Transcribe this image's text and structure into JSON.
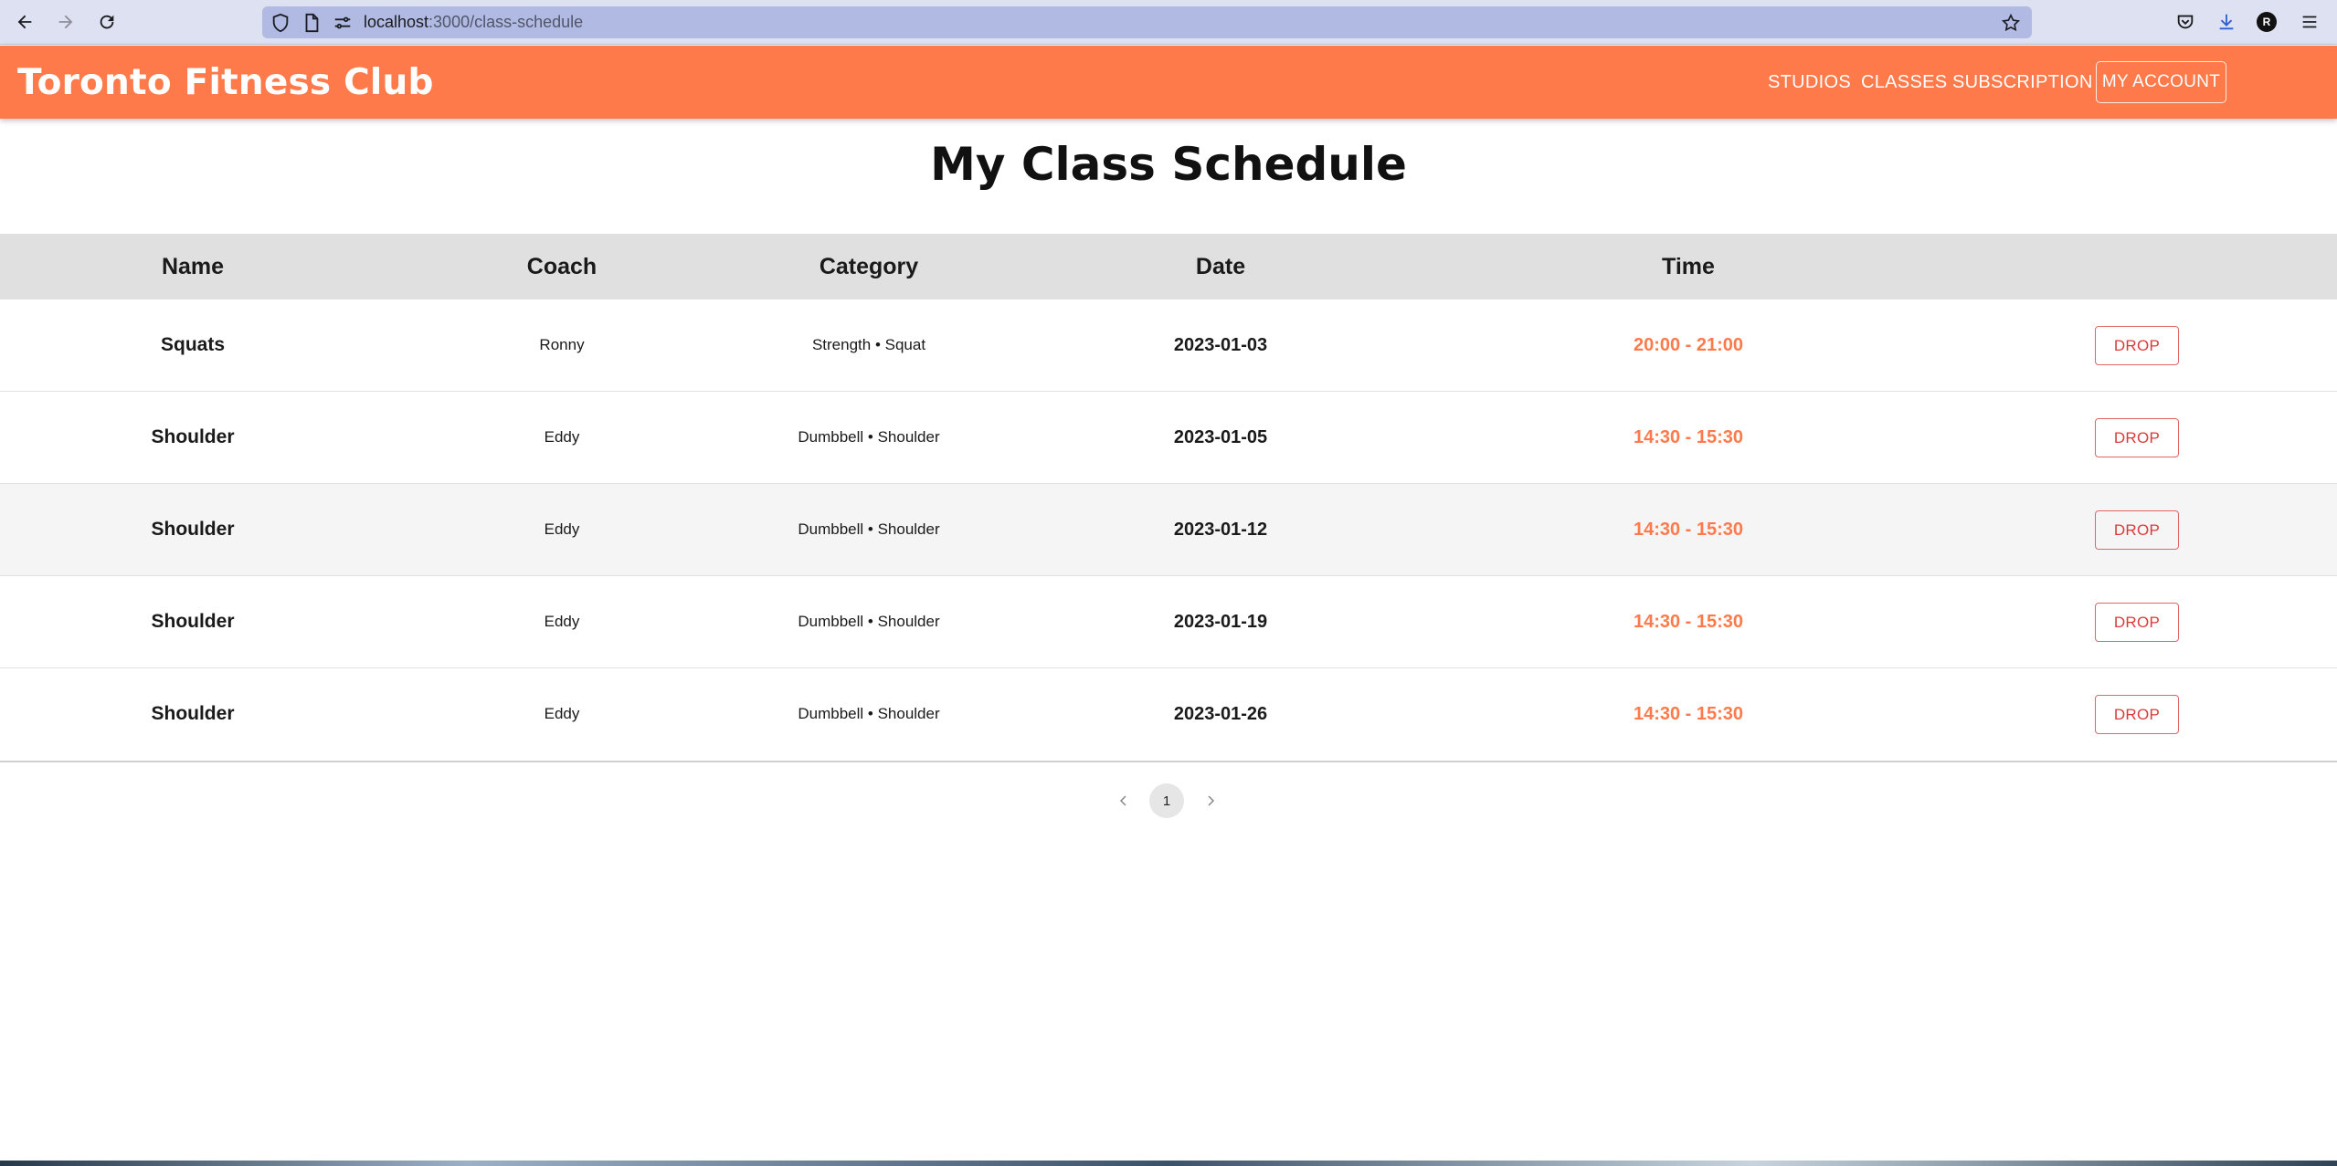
{
  "browser": {
    "url_host": "localhost",
    "url_path": ":3000/class-schedule",
    "profile_initial": "R"
  },
  "header": {
    "brand": "Toronto Fitness Club",
    "nav": [
      "STUDIOS",
      "CLASSES",
      "SUBSCRIPTION"
    ],
    "account_label": "MY ACCOUNT",
    "accent_color": "#ff7a4a"
  },
  "page": {
    "title": "My Class Schedule"
  },
  "table": {
    "columns": [
      "Name",
      "Coach",
      "Category",
      "Date",
      "Time"
    ],
    "rows": [
      {
        "name": "Squats",
        "coach": "Ronny",
        "category": "Strength • Squat",
        "date": "2023-01-03",
        "time": "20:00 - 21:00",
        "action": "DROP"
      },
      {
        "name": "Shoulder",
        "coach": "Eddy",
        "category": "Dumbbell • Shoulder",
        "date": "2023-01-05",
        "time": "14:30 - 15:30",
        "action": "DROP"
      },
      {
        "name": "Shoulder",
        "coach": "Eddy",
        "category": "Dumbbell • Shoulder",
        "date": "2023-01-12",
        "time": "14:30 - 15:30",
        "action": "DROP"
      },
      {
        "name": "Shoulder",
        "coach": "Eddy",
        "category": "Dumbbell • Shoulder",
        "date": "2023-01-19",
        "time": "14:30 - 15:30",
        "action": "DROP"
      },
      {
        "name": "Shoulder",
        "coach": "Eddy",
        "category": "Dumbbell • Shoulder",
        "date": "2023-01-26",
        "time": "14:30 - 15:30",
        "action": "DROP"
      }
    ]
  },
  "pagination": {
    "current_page": "1"
  }
}
